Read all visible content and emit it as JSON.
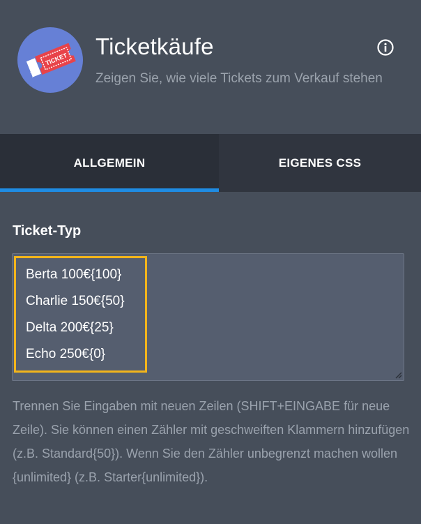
{
  "header": {
    "title": "Ticketkäufe",
    "subtitle": "Zeigen Sie, wie viele Tickets zum Verkauf stehen",
    "icon": "ticket-icon",
    "ticket_text": "TICKET",
    "info_icon": "info-icon"
  },
  "tabs": [
    {
      "label": "ALLGEMEIN",
      "active": true
    },
    {
      "label": "EIGENES CSS",
      "active": false
    }
  ],
  "field": {
    "label": "Ticket-Typ",
    "lines": [
      "Berta 100€{100}",
      "Charlie 150€{50}",
      "Delta 200€{25}",
      "Echo 250€{0}"
    ],
    "help": "Trennen Sie Eingaben mit neuen Zeilen (SHIFT+EINGABE für neue Zeile). Sie können einen Zähler mit geschweiften Klammern hinzufügen (z.B. Standard{50}). Wenn Sie den Zähler unbegrenzt machen wollen {unlimited} (z.B. Starter{unlimited})."
  },
  "colors": {
    "panel": "#464e5a",
    "tabbar": "#2f343e",
    "active_underline": "#1f8ce3",
    "avatar": "#6680d6",
    "ticket": "#e8434a",
    "highlight": "#f3b51b",
    "textarea": "#555e6f"
  }
}
